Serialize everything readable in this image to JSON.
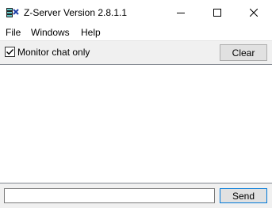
{
  "window": {
    "title": "Z-Server Version 2.8.1.1",
    "app_icon": "z-server-app-icon"
  },
  "controls": {
    "minimize_icon": "minimize-icon",
    "maximize_icon": "maximize-icon",
    "close_icon": "close-icon"
  },
  "menu": {
    "items": [
      {
        "label": "File"
      },
      {
        "label": "Windows"
      },
      {
        "label": "Help"
      }
    ]
  },
  "toolbar": {
    "monitor_chat_only": {
      "label": "Monitor chat only",
      "checked": true
    },
    "clear_label": "Clear"
  },
  "chat": {
    "messages": []
  },
  "input": {
    "value": "",
    "send_label": "Send"
  },
  "colors": {
    "titlebar_bg": "#ffffff",
    "window_bg": "#f0f0f0",
    "button_bg": "#e1e1e1",
    "focus_border": "#0078d7"
  }
}
